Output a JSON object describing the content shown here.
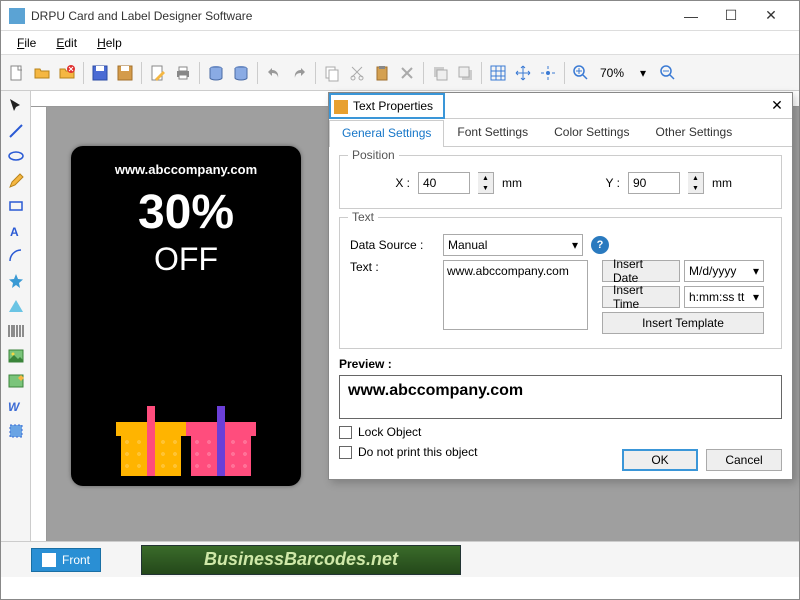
{
  "app": {
    "title": "DRPU Card and Label Designer Software"
  },
  "menu": {
    "file": "File",
    "edit": "Edit",
    "help": "Help"
  },
  "toolbar": {
    "zoom": "70%"
  },
  "canvas": {
    "card_url": "www.abccompany.com",
    "card_big": "30%",
    "card_off": "OFF"
  },
  "dialog": {
    "title": "Text Properties",
    "tabs": {
      "general": "General Settings",
      "font": "Font Settings",
      "color": "Color Settings",
      "other": "Other Settings"
    },
    "position": {
      "legend": "Position",
      "xlabel": "X :",
      "xval": "40",
      "xunit": "mm",
      "ylabel": "Y :",
      "yval": "90",
      "yunit": "mm"
    },
    "text": {
      "legend": "Text",
      "ds_label": "Data Source :",
      "ds_val": "Manual",
      "text_label": "Text :",
      "text_val": "www.abccompany.com",
      "insert_date": "Insert Date",
      "date_fmt": "M/d/yyyy",
      "insert_time": "Insert Time",
      "time_fmt": "h:mm:ss tt",
      "insert_tmpl": "Insert Template"
    },
    "preview": {
      "label": "Preview :",
      "value": "www.abccompany.com"
    },
    "lock": "Lock Object",
    "noprint": "Do not print this object",
    "ok": "OK",
    "cancel": "Cancel"
  },
  "footer": {
    "page": "Front",
    "banner": "BusinessBarcodes.net"
  }
}
